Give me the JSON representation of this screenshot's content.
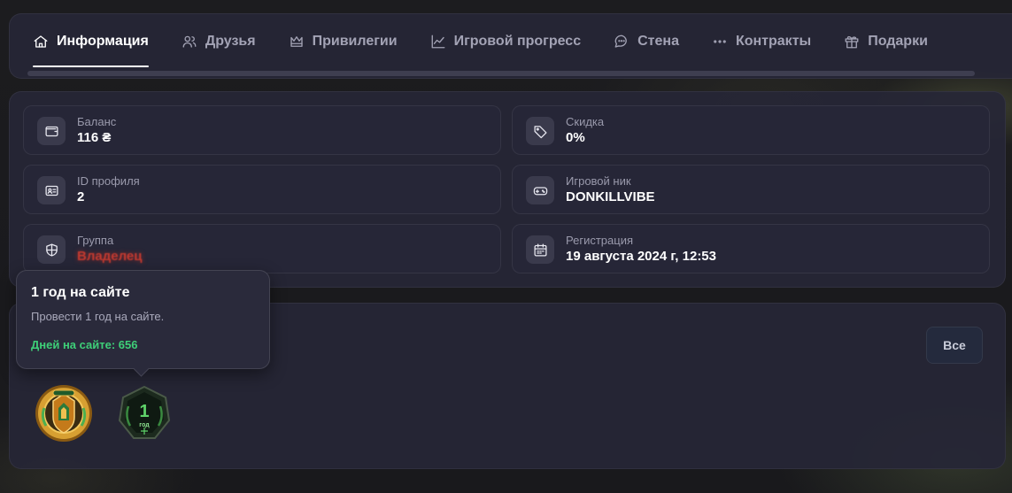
{
  "tabs": [
    {
      "label": "Информация",
      "icon": "home-icon",
      "active": true
    },
    {
      "label": "Друзья",
      "icon": "users-icon"
    },
    {
      "label": "Привилегии",
      "icon": "crown-icon"
    },
    {
      "label": "Игровой прогресс",
      "icon": "chart-line-icon"
    },
    {
      "label": "Стена",
      "icon": "chat-bubble-icon"
    },
    {
      "label": "Контракты",
      "icon": "dots-icon"
    },
    {
      "label": "Подарки",
      "icon": "gift-icon"
    }
  ],
  "info": {
    "balance": {
      "label": "Баланс",
      "value": "116 ₴",
      "icon": "wallet-icon"
    },
    "discount": {
      "label": "Скидка",
      "value": "0%",
      "icon": "tag-icon"
    },
    "profile_id": {
      "label": "ID профиля",
      "value": "2",
      "icon": "id-card-icon"
    },
    "nickname": {
      "label": "Игровой ник",
      "value": "DONKILLVIBE",
      "icon": "gamepad-icon"
    },
    "group": {
      "label": "Группа",
      "value": "Владелец",
      "icon": "shield-icon",
      "color": "#c23a30"
    },
    "registration": {
      "label": "Регистрация",
      "value": "19 августа 2024 г, 12:53",
      "icon": "calendar-icon"
    }
  },
  "achievements": {
    "all_button": "Все",
    "badges": [
      {
        "name": "gold-crest-badge"
      },
      {
        "name": "one-year-badge",
        "text": "1",
        "sub": "год"
      }
    ]
  },
  "tooltip": {
    "title": "1 год на сайте",
    "description": "Провести 1 год на сайте.",
    "stat": "Дней на сайте: 656"
  },
  "colors": {
    "accent_green": "#3ecf78",
    "panel_bg": "#26263a",
    "owner_red": "#c23a30"
  }
}
